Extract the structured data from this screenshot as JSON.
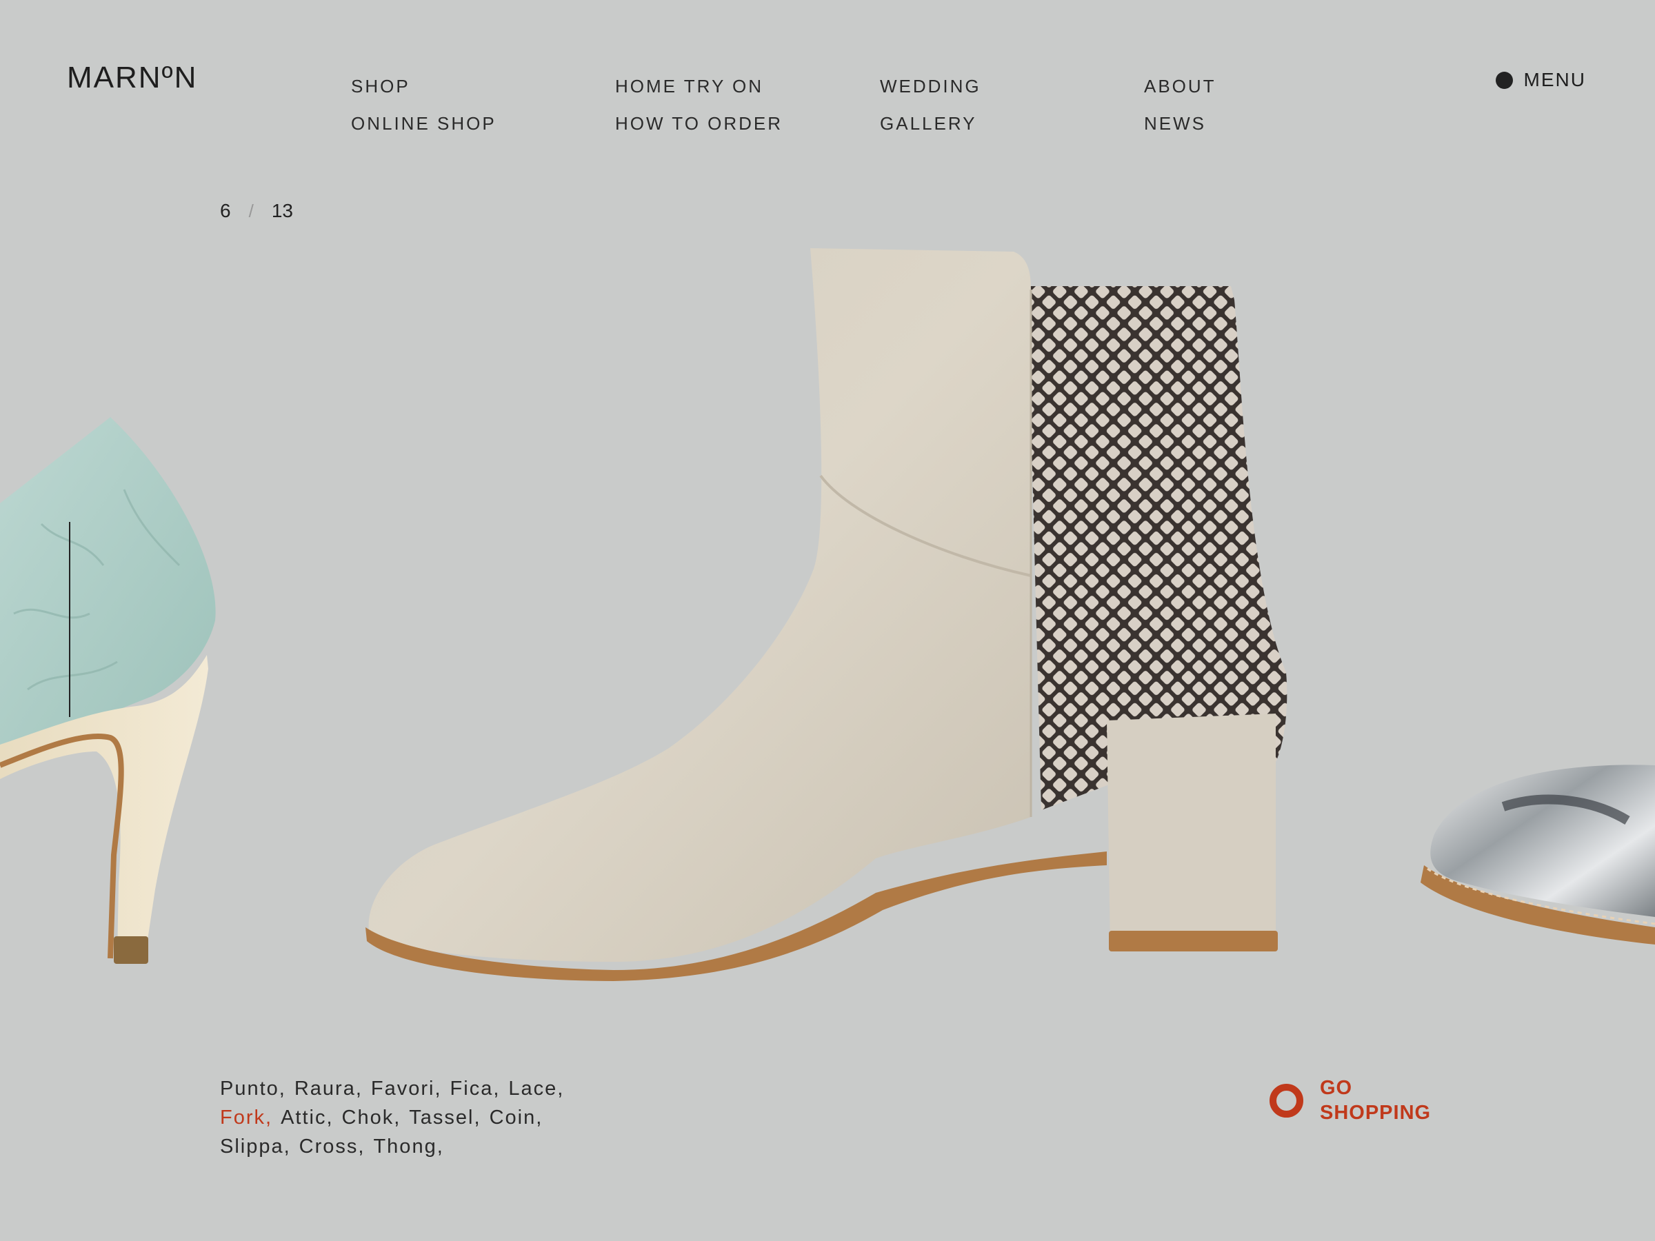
{
  "brand": {
    "logo": "MARNºN"
  },
  "nav": {
    "col1": [
      "SHOP",
      "ONLINE SHOP"
    ],
    "col2": [
      "HOME TRY ON",
      "HOW TO ORDER"
    ],
    "col3": [
      "WEDDING",
      "GALLERY"
    ],
    "col4": [
      "ABOUT",
      "NEWS"
    ]
  },
  "menu": {
    "label": "MENU",
    "icon": "dot-icon"
  },
  "carousel": {
    "current": "6",
    "separator": "/",
    "total": "13"
  },
  "product_names": {
    "items": [
      "Punto,",
      "Raura,",
      "Favori,",
      "Fica,",
      "Lace,",
      "Fork,",
      "Attic,",
      "Chok,",
      "Tassel,",
      "Coin,",
      "Slippa,",
      "Cross,",
      "Thong,"
    ],
    "active_index": 5
  },
  "cta": {
    "label_line1": "GO",
    "label_line2": "SHOPPING",
    "icon": "ring-icon"
  },
  "colors": {
    "background": "#c9cbca",
    "accent": "#c0391b",
    "text": "#222222"
  }
}
